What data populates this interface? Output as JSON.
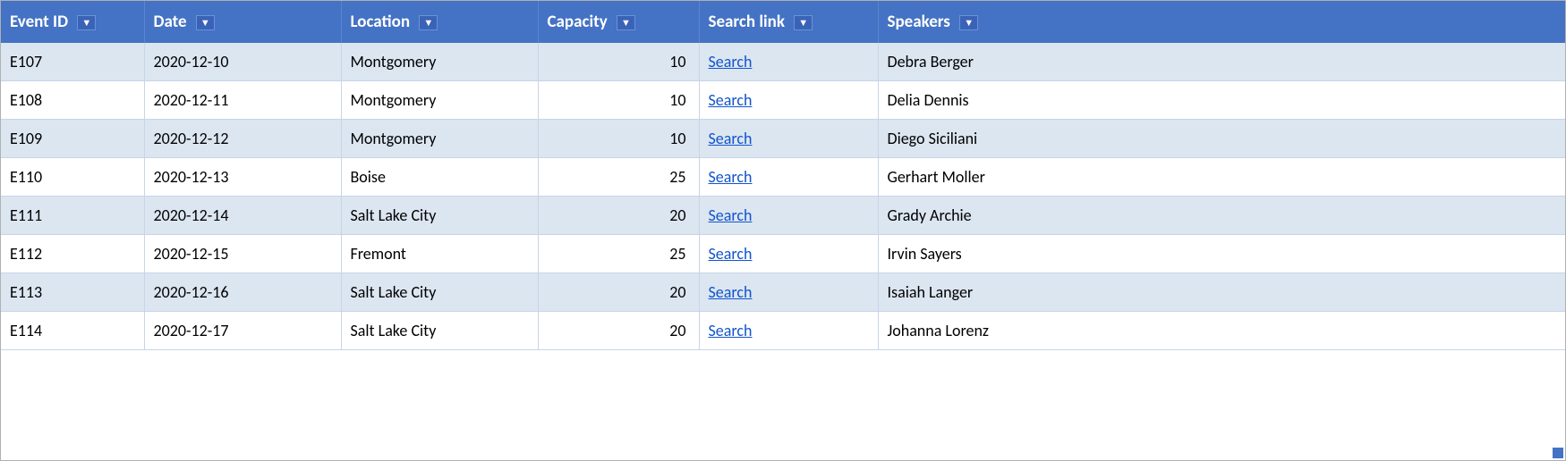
{
  "table": {
    "columns": [
      {
        "id": "event-id-col",
        "label": "Event ID",
        "key": "eventId"
      },
      {
        "id": "date-col",
        "label": "Date",
        "key": "date"
      },
      {
        "id": "location-col",
        "label": "Location",
        "key": "location"
      },
      {
        "id": "capacity-col",
        "label": "Capacity",
        "key": "capacity"
      },
      {
        "id": "search-link-col",
        "label": "Search link",
        "key": "searchLink"
      },
      {
        "id": "speakers-col",
        "label": "Speakers",
        "key": "speakers"
      }
    ],
    "filter_button_label": "▼",
    "rows": [
      {
        "eventId": "E107",
        "date": "2020-12-10",
        "location": "Montgomery",
        "capacity": "10",
        "searchLink": "Search",
        "speakers": "Debra Berger"
      },
      {
        "eventId": "E108",
        "date": "2020-12-11",
        "location": "Montgomery",
        "capacity": "10",
        "searchLink": "Search",
        "speakers": "Delia Dennis"
      },
      {
        "eventId": "E109",
        "date": "2020-12-12",
        "location": "Montgomery",
        "capacity": "10",
        "searchLink": "Search",
        "speakers": "Diego Siciliani"
      },
      {
        "eventId": "E110",
        "date": "2020-12-13",
        "location": "Boise",
        "capacity": "25",
        "searchLink": "Search",
        "speakers": "Gerhart Moller"
      },
      {
        "eventId": "E111",
        "date": "2020-12-14",
        "location": "Salt Lake City",
        "capacity": "20",
        "searchLink": "Search",
        "speakers": "Grady Archie"
      },
      {
        "eventId": "E112",
        "date": "2020-12-15",
        "location": "Fremont",
        "capacity": "25",
        "searchLink": "Search",
        "speakers": "Irvin Sayers"
      },
      {
        "eventId": "E113",
        "date": "2020-12-16",
        "location": "Salt Lake City",
        "capacity": "20",
        "searchLink": "Search",
        "speakers": "Isaiah Langer"
      },
      {
        "eventId": "E114",
        "date": "2020-12-17",
        "location": "Salt Lake City",
        "capacity": "20",
        "searchLink": "Search",
        "speakers": "Johanna Lorenz"
      }
    ]
  },
  "colors": {
    "header_bg": "#4472C4",
    "odd_row": "#dce6f1",
    "even_row": "#ffffff",
    "link": "#1155CC"
  }
}
